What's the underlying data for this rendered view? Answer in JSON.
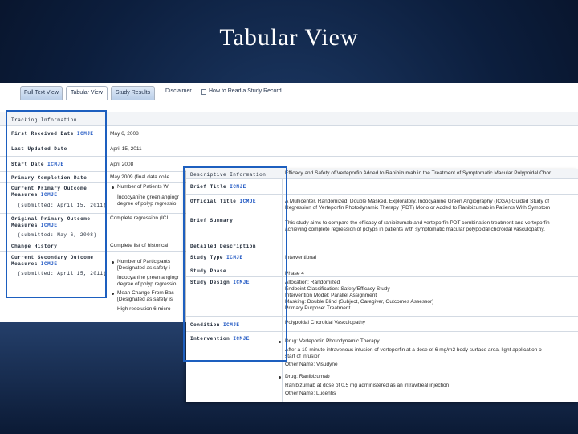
{
  "slide": {
    "title": "Tabular View"
  },
  "tabs": {
    "full_text": "Full Text View",
    "tabular": "Tabular View",
    "study_results": "Study Results",
    "disclaimer": "Disclaimer",
    "how_to_read": "How to Read a Study Record"
  },
  "tracking": {
    "header": "Tracking Information",
    "first_received_label": "First Received Date",
    "first_received_value": "May 6, 2008",
    "last_updated_label": "Last Updated Date",
    "last_updated_value": "April 15, 2011",
    "start_label": "Start Date",
    "start_value": "April 2008",
    "primary_completion_label": "Primary Completion Date",
    "primary_completion_value": "May 2009 (final data colle",
    "current_primary_label_1": "Current Primary Outcome",
    "current_primary_label_2": "Measures",
    "current_primary_submitted": "(submitted: April 15, 2011)",
    "current_primary_value_1": "Number of Patients Wi",
    "current_primary_value_2": "Indocyanine green angiogr",
    "current_primary_value_3": "degree of polyp regressio",
    "original_primary_label_1": "Original Primary Outcome",
    "original_primary_label_2": "Measures",
    "original_primary_submitted": "(submitted: May 6, 2008)",
    "original_primary_value": "Complete regression (ICI",
    "change_history_label": "Change History",
    "change_history_value": "Complete list of historical",
    "current_secondary_label_1": "Current Secondary Outcome",
    "current_secondary_label_2": "Measures",
    "current_secondary_submitted": "(submitted: April 15, 2011)",
    "current_secondary_value_1": "Number of Participants",
    "current_secondary_value_2": "[Designated as safety i",
    "current_secondary_value_3": "Indocyanine green angiogr",
    "current_secondary_value_4": "degree of polyp regressio",
    "current_secondary_value_5": "Mean Change From Bas",
    "current_secondary_value_6": "[Designated as safety is",
    "current_secondary_value_7": "High resolution 6 micro",
    "icmje": "ICMJE"
  },
  "descriptive": {
    "header": "Descriptive Information",
    "brief_title_label": "Brief Title",
    "brief_title_value": "Efficacy and Safety of Verteporfin Added to Ranibizumab in the Treatment of Symptomatic Macular Polypoidal Chor",
    "official_title_label": "Official Title",
    "official_title_value_1": "A Multicenter, Randomized, Double Masked, Exploratory, Indocyanine Green Angiography (ICGA) Guided Study of",
    "official_title_value_2": "Regression of Verteporfin Photodynamic Therapy (PDT) Mono or Added to Ranibizumab in Patients With Symptom",
    "brief_summary_label": "Brief Summary",
    "brief_summary_value_1": "This study aims to compare the efficacy of ranibizumab and verteporfin PDT combination treatment and verteporfin",
    "brief_summary_value_2": "achieving complete regression of polyps in patients with symptomatic macular polypoidal choroidal vasculopathy.",
    "detailed_description_label": "Detailed Description",
    "study_type_label": "Study Type",
    "study_type_value": "Interventional",
    "study_phase_label": "Study Phase",
    "study_phase_value": "Phase 4",
    "study_design_label": "Study Design",
    "study_design_value_1": "Allocation: Randomized",
    "study_design_value_2": "Endpoint Classification: Safety/Efficacy Study",
    "study_design_value_3": "Intervention Model: Parallel Assignment",
    "study_design_value_4": "Masking: Double Blind (Subject, Caregiver, Outcomes Assessor)",
    "study_design_value_5": "Primary Purpose: Treatment",
    "condition_label": "Condition",
    "condition_value": "Polypoidal Choroidal Vasculopathy",
    "intervention_label": "Intervention",
    "intervention_value_1": "Drug: Verteporfin Photodynamic Therapy",
    "intervention_value_2": "After a 10-minute intravenous infusion of verteporfin at a dose of 6 mg/m2 body surface area, light application o",
    "intervention_value_3": "start of infusion",
    "intervention_value_4": "Other Name: Visudyne",
    "intervention_value_5": "Drug: Ranibizumab",
    "intervention_value_6": "Ranibizumab at dose of 0.5 mg administered as an intravitreal injection",
    "intervention_value_7": "Other Name: Lucentis",
    "icmje": "ICMJE"
  },
  "colors": {
    "frame": "#1d5fbf",
    "link": "#1e56c2",
    "background": "#0c1e3d"
  }
}
